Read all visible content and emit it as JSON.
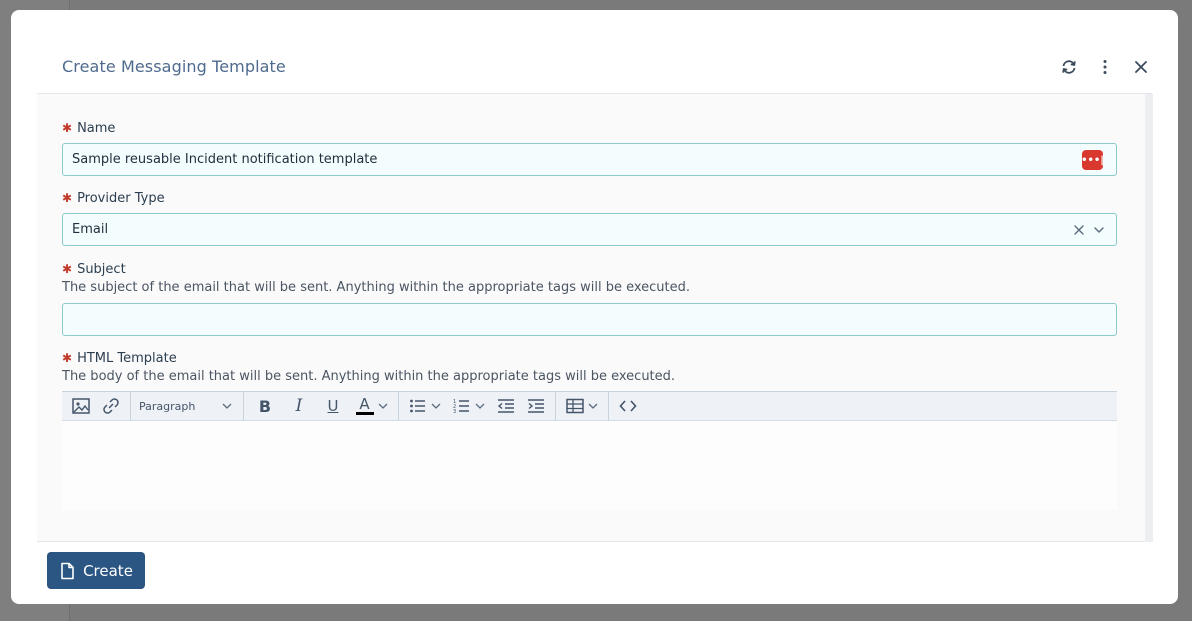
{
  "dialog": {
    "title": "Create Messaging Template",
    "header_actions": [
      "refresh-icon",
      "more-vertical-icon",
      "close-icon"
    ]
  },
  "form": {
    "name": {
      "label": "Name",
      "value": "Sample reusable Incident notification template",
      "badge_icon": "password-manager-icon"
    },
    "provider_type": {
      "label": "Provider Type",
      "value": "Email"
    },
    "subject": {
      "label": "Subject",
      "help": "The subject of the email that will be sent. Anything within the appropriate tags will be executed.",
      "value": ""
    },
    "html_template": {
      "label": "HTML Template",
      "help": "The body of the email that will be sent. Anything within the appropriate tags will be executed.",
      "toolbar": {
        "paragraph_label": "Paragraph",
        "font_color": "#000000"
      }
    }
  },
  "footer": {
    "create_label": "Create"
  },
  "colors": {
    "accent": "#2b5582",
    "required": "#c0392b",
    "input_border": "#8ec9c9"
  }
}
